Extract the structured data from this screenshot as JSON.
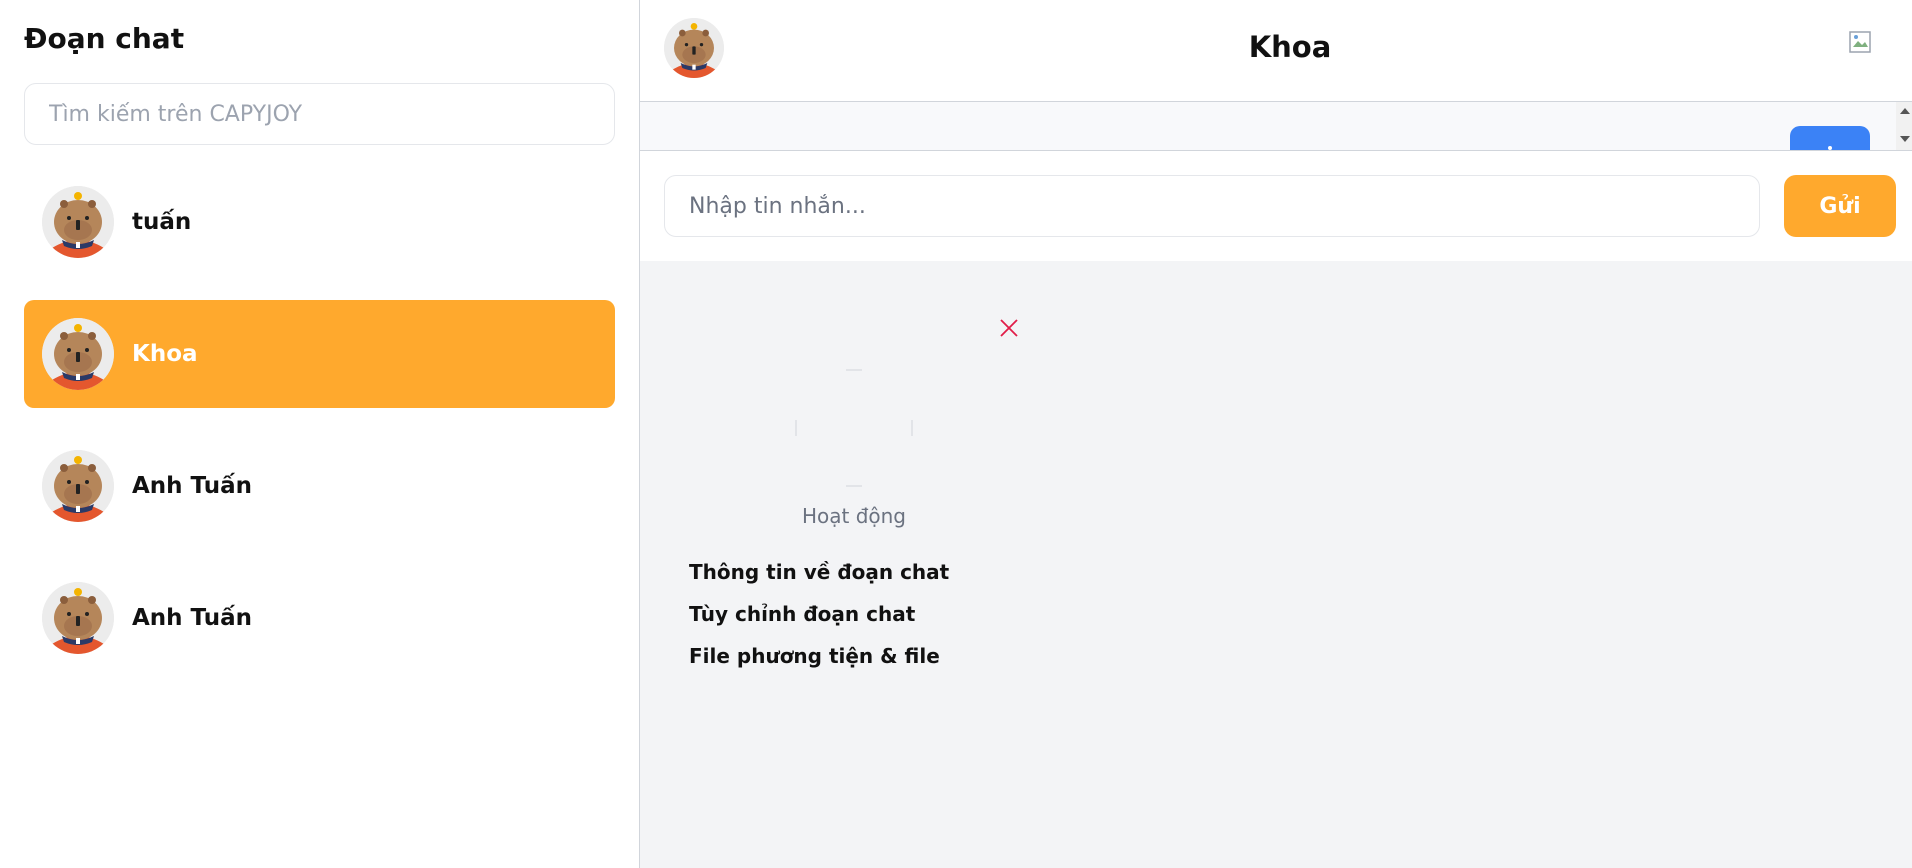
{
  "sidebar": {
    "title": "Đoạn chat",
    "search_placeholder": "Tìm kiếm trên CAPYJOY",
    "chats": [
      {
        "name": "tuấn",
        "active": false
      },
      {
        "name": "Khoa",
        "active": true
      },
      {
        "name": "Anh Tuấn",
        "active": false
      },
      {
        "name": "Anh Tuấn",
        "active": false
      }
    ]
  },
  "header": {
    "title": "Khoa"
  },
  "composer": {
    "placeholder": "Nhập tin nhắn...",
    "send_label": "Gửi"
  },
  "info": {
    "status": "Hoạt động",
    "links": [
      "Thông tin về đoạn chat",
      "Tùy chỉnh đoạn chat",
      "File phương tiện & file"
    ]
  },
  "colors": {
    "accent": "#ffa92d",
    "message_bubble": "#3b82f6",
    "close_icon": "#e11d48"
  }
}
